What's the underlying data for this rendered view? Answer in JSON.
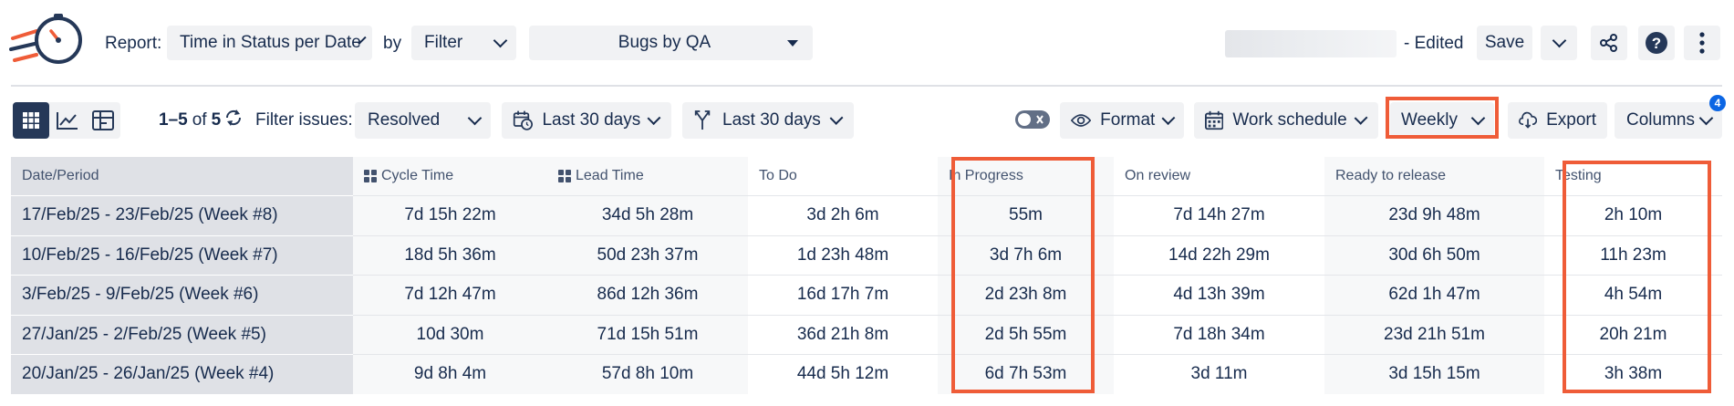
{
  "header": {
    "report_label": "Report:",
    "report_value": "Time in Status per Date",
    "by_label": "by",
    "filter_value": "Filter",
    "filter_name": "Bugs by QA",
    "edited_label": "- Edited",
    "save_label": "Save"
  },
  "toolbar": {
    "count_range": "1–5",
    "count_of": "of",
    "count_total": "5",
    "filter_issues_label": "Filter issues:",
    "filter_issues_value": "Resolved",
    "date_range_1": "Last 30 days",
    "date_range_2": "Last 30 days",
    "format_label": "Format",
    "work_schedule_label": "Work schedule",
    "period_value": "Weekly",
    "export_label": "Export",
    "columns_label": "Columns",
    "columns_badge": "4"
  },
  "table": {
    "headers": [
      "Date/Period",
      "Cycle Time",
      "Lead Time",
      "To Do",
      "In Progress",
      "On review",
      "Ready to release",
      "Testing"
    ],
    "rows": [
      [
        "17/Feb/25 - 23/Feb/25 (Week #8)",
        "7d 15h 22m",
        "34d 5h 28m",
        "3d 2h 6m",
        "55m",
        "7d 14h 27m",
        "23d 9h 48m",
        "2h 10m"
      ],
      [
        "10/Feb/25 - 16/Feb/25 (Week #7)",
        "18d 5h 36m",
        "50d 23h 37m",
        "1d 23h 48m",
        "3d 7h 6m",
        "14d 22h 29m",
        "30d 6h 50m",
        "11h 23m"
      ],
      [
        "3/Feb/25 - 9/Feb/25 (Week #6)",
        "7d 12h 47m",
        "86d 12h 36m",
        "16d 17h 7m",
        "2d 23h 8m",
        "4d 13h 39m",
        "62d 1h 47m",
        "4h 54m"
      ],
      [
        "27/Jan/25 - 2/Feb/25 (Week #5)",
        "10d 30m",
        "71d 15h 51m",
        "36d 21h 8m",
        "2d 5h 55m",
        "7d 18h 34m",
        "23d 21h 51m",
        "20h 21m"
      ],
      [
        "20/Jan/25 - 26/Jan/25 (Week #4)",
        "9d 8h 4m",
        "57d 8h 10m",
        "44d 5h 12m",
        "6d 7h 53m",
        "3d 11m",
        "3d 15h 15m",
        "3h 38m"
      ]
    ]
  },
  "colors": {
    "accent": "#ef5c38",
    "primary_dark": "#253858",
    "badge": "#0c66e4"
  },
  "icons": [
    "app-logo-icon",
    "chevron-down-icon",
    "share-icon",
    "help-icon",
    "more-vertical-icon",
    "grid-view-icon",
    "chart-view-icon",
    "pivot-view-icon",
    "refresh-icon",
    "calendar-clock-icon",
    "merge-icon",
    "toggle-icon",
    "eye-icon",
    "calendar-icon",
    "cloud-download-icon"
  ]
}
